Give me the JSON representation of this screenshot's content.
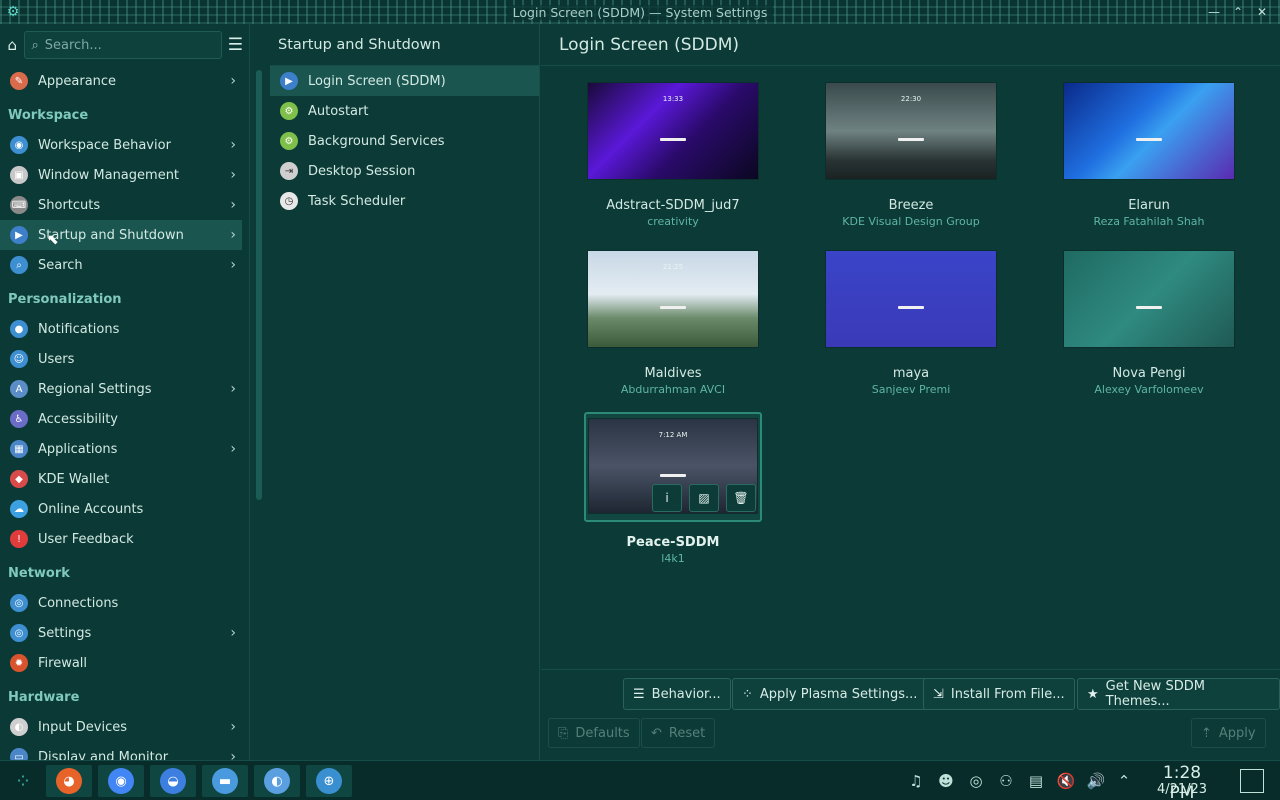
{
  "window": {
    "title": "Login Screen (SDDM) — System Settings"
  },
  "sidebar": {
    "search_placeholder": "Search...",
    "items": [
      {
        "label": "Appearance",
        "icon": "appearance-icon",
        "color": "#d76b4b",
        "chevron": true
      },
      {
        "header": "Workspace"
      },
      {
        "label": "Workspace Behavior",
        "icon": "workspace-behavior-icon",
        "color": "#3d8fd1",
        "chevron": true
      },
      {
        "label": "Window Management",
        "icon": "window-management-icon",
        "color": "#c8c8c8",
        "chevron": true
      },
      {
        "label": "Shortcuts",
        "icon": "keyboard-icon",
        "color": "#8a8a8a",
        "chevron": true
      },
      {
        "label": "Startup and Shutdown",
        "icon": "startup-icon",
        "color": "#3d7fc8",
        "chevron": true,
        "active": true
      },
      {
        "label": "Search",
        "icon": "search-icon",
        "color": "#3d8fd1",
        "chevron": true
      },
      {
        "header": "Personalization"
      },
      {
        "label": "Notifications",
        "icon": "notifications-icon",
        "color": "#3d8fd1",
        "chevron": false
      },
      {
        "label": "Users",
        "icon": "users-icon",
        "color": "#3d8fd1",
        "chevron": false
      },
      {
        "label": "Regional Settings",
        "icon": "regional-settings-icon",
        "color": "#5b8ec7",
        "chevron": true
      },
      {
        "label": "Accessibility",
        "icon": "accessibility-icon",
        "color": "#6b6bc8",
        "chevron": false
      },
      {
        "label": "Applications",
        "icon": "applications-icon",
        "color": "#4a86c8",
        "chevron": true
      },
      {
        "label": "KDE Wallet",
        "icon": "wallet-icon",
        "color": "#d94b4b",
        "chevron": false
      },
      {
        "label": "Online Accounts",
        "icon": "cloud-icon",
        "color": "#3da0e0",
        "chevron": false
      },
      {
        "label": "User Feedback",
        "icon": "feedback-icon",
        "color": "#e03c3c",
        "chevron": false
      },
      {
        "header": "Network"
      },
      {
        "label": "Connections",
        "icon": "connections-icon",
        "color": "#3d8fd1",
        "chevron": false
      },
      {
        "label": "Settings",
        "icon": "network-settings-icon",
        "color": "#3d8fd1",
        "chevron": true
      },
      {
        "label": "Firewall",
        "icon": "firewall-icon",
        "color": "#d9532c",
        "chevron": false
      },
      {
        "header": "Hardware"
      },
      {
        "label": "Input Devices",
        "icon": "input-devices-icon",
        "color": "#cfcfcf",
        "chevron": true
      },
      {
        "label": "Display and Monitor",
        "icon": "display-icon",
        "color": "#4a86c8",
        "chevron": true
      }
    ]
  },
  "middle": {
    "title": "Startup and Shutdown",
    "items": [
      {
        "label": "Login Screen (SDDM)",
        "icon": "login-screen-icon",
        "color": "#3d7fc8",
        "active": true
      },
      {
        "label": "Autostart",
        "icon": "autostart-icon",
        "color": "#7fc04a"
      },
      {
        "label": "Background Services",
        "icon": "background-services-icon",
        "color": "#7fc04a"
      },
      {
        "label": "Desktop Session",
        "icon": "desktop-session-icon",
        "color": "#cfcfcf"
      },
      {
        "label": "Task Scheduler",
        "icon": "task-scheduler-icon",
        "color": "#e8e8e8"
      }
    ]
  },
  "main": {
    "title": "Login Screen (SDDM)",
    "themes": [
      {
        "name": "Adstract-SDDM_jud7",
        "author": "creativity",
        "bg": "linear-gradient(135deg,#1a0a3a 0%,#5a18d8 35%,#2a0a6a 60%,#0a0820 100%)",
        "clock": "13:33"
      },
      {
        "name": "Breeze",
        "author": "KDE Visual Design Group",
        "bg": "linear-gradient(180deg,#3a4a4c 0%,#6f8282 50%,#2a3434 80%,#1a2222 100%)",
        "clock": "22:30"
      },
      {
        "name": "Elarun",
        "author": "Reza Fatahilah Shah",
        "bg": "linear-gradient(135deg,#0a2a8a 0%,#1f6fe0 40%,#3aa0f0 55%,#5a2ab0 100%)",
        "clock": ""
      },
      {
        "name": "Maldives",
        "author": "Abdurrahman AVCI",
        "bg": "linear-gradient(180deg,#c8d8e6 0%,#e3ecf2 45%,#6a8a6a 70%,#3a5a3a 100%)",
        "clock": "21:25"
      },
      {
        "name": "maya",
        "author": "Sanjeev Premi",
        "bg": "linear-gradient(180deg,#3a44c8 0%,#3a3ab8 100%)",
        "clock": ""
      },
      {
        "name": "Nova Pengi",
        "author": "Alexey Varfolomeev",
        "bg": "linear-gradient(135deg,#1f6a62 0%,#2f8a80 50%,#1f5a54 100%)",
        "clock": ""
      },
      {
        "name": "Peace-SDDM",
        "author": "l4k1",
        "bg": "linear-gradient(180deg,#2a3444 0%,#4a5466 50%,#1e2632 100%)",
        "clock": "7:12 AM",
        "selected": true
      }
    ],
    "overlay_icons": [
      "info-icon",
      "image-icon",
      "delete-icon"
    ]
  },
  "buttons": {
    "behavior": "Behavior...",
    "apply_plasma": "Apply Plasma Settings...",
    "install_from_file": "Install From File...",
    "get_new": "Get New SDDM Themes...",
    "defaults": "Defaults",
    "reset": "Reset",
    "apply": "Apply"
  },
  "taskbar": {
    "apps": [
      {
        "name": "app-launcher-icon",
        "color": "#3aa090"
      },
      {
        "name": "firefox-icon",
        "color": "#e8632a"
      },
      {
        "name": "chrome-icon",
        "color": "#4285f4"
      },
      {
        "name": "discover-icon",
        "color": "#3d7fe0"
      },
      {
        "name": "dolphin-icon",
        "color": "#4a9ae0"
      },
      {
        "name": "system-settings-icon",
        "color": "#5aa0e0"
      },
      {
        "name": "help-icon",
        "color": "#3a8fd0"
      }
    ],
    "tray_icons": [
      "notifications-tray-icon",
      "user-tray-icon",
      "update-tray-icon",
      "network-tray-icon",
      "clipboard-tray-icon",
      "mute-tray-icon",
      "volume-tray-icon",
      "expand-tray-icon"
    ],
    "time": "1:28 PM",
    "date": "4/21/23"
  }
}
